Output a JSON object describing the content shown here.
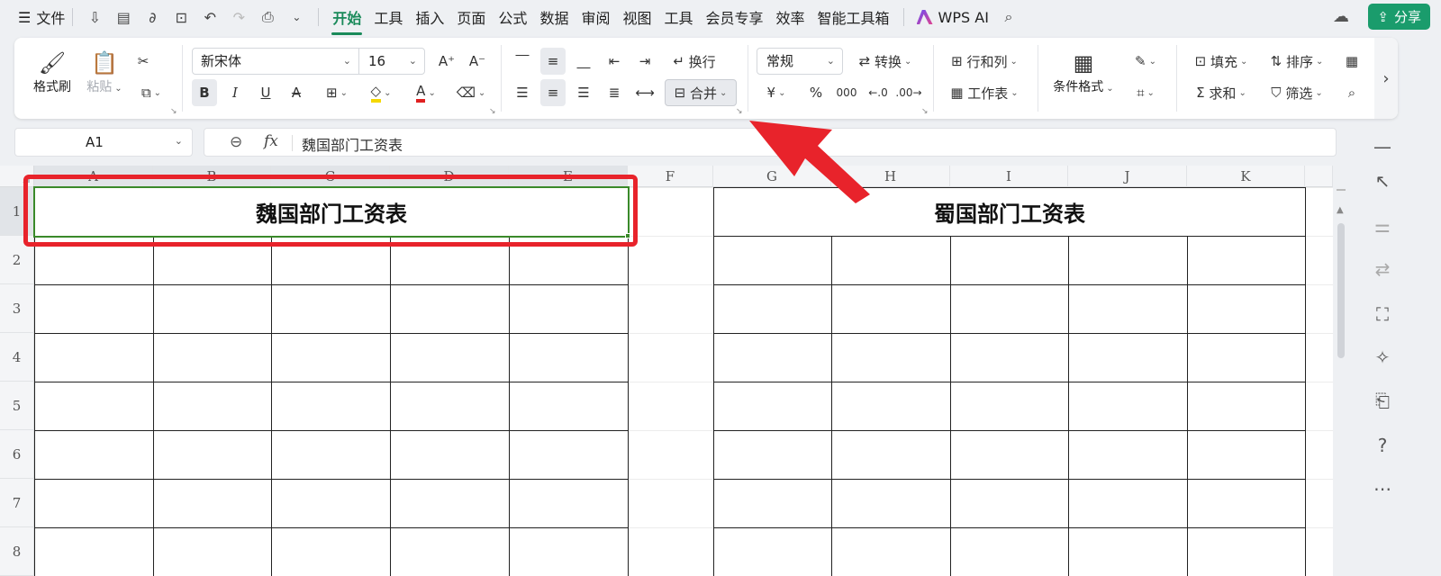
{
  "menubar": {
    "file_label": "文件",
    "tabs": [
      "开始",
      "工具",
      "插入",
      "页面",
      "公式",
      "数据",
      "审阅",
      "视图",
      "工具",
      "会员专享",
      "效率",
      "智能工具箱"
    ],
    "active_tab": "开始",
    "wps_ai_label": "WPS AI",
    "share_label": "分享"
  },
  "ribbon": {
    "format_painter": "格式刷",
    "paste": "粘贴",
    "font_name": "新宋体",
    "font_size": "16",
    "wrap": "换行",
    "merge": "合并",
    "number_format": "常规",
    "convert": "转换",
    "rows_cols": "行和列",
    "worksheet": "工作表",
    "conditional_format": "条件格式",
    "fill": "填充",
    "sort": "排序",
    "sum": "求和",
    "filter": "筛选",
    "currency_symbol": "¥",
    "percent_symbol": "%",
    "thousands_symbol": "000"
  },
  "formula_bar": {
    "cell_ref": "A1",
    "fx": "fx",
    "content": "魏国部门工资表"
  },
  "sheet": {
    "columns": [
      "A",
      "B",
      "C",
      "D",
      "E",
      "F",
      "G",
      "H",
      "I",
      "J",
      "K"
    ],
    "rows": [
      "1",
      "2",
      "3",
      "4",
      "5",
      "6",
      "7",
      "8"
    ],
    "title_left": "魏国部门工资表",
    "title_right": "蜀国部门工资表"
  },
  "colors": {
    "accent": "#1a8a5a",
    "share_button": "#1a9c6c",
    "selection_border": "#3a8a2a",
    "annotation_red": "#e8232b"
  }
}
